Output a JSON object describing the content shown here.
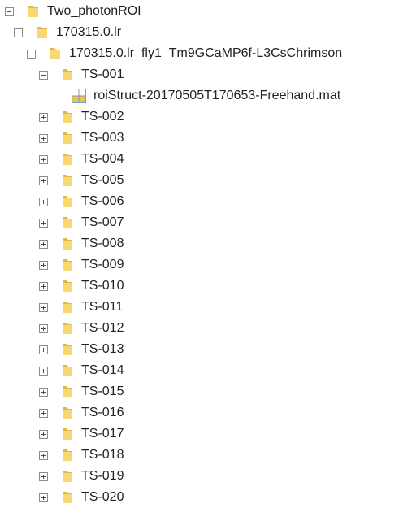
{
  "tree": {
    "root": {
      "label": "Two_photonROI",
      "expanded": true
    },
    "date_folder": {
      "label": "170315.0.lr",
      "expanded": true
    },
    "fly_folder": {
      "label": "170315.0.lr_fly1_Tm9GCaMP6f-L3CsChrimson",
      "expanded": true
    },
    "ts_expanded": {
      "label": "TS-001",
      "expanded": true
    },
    "file": {
      "label": "roiStruct-20170505T170653-Freehand.mat",
      "icon": "mat-file-icon"
    },
    "ts_collapsed": [
      {
        "label": "TS-002"
      },
      {
        "label": "TS-003"
      },
      {
        "label": "TS-004"
      },
      {
        "label": "TS-005"
      },
      {
        "label": "TS-006"
      },
      {
        "label": "TS-007"
      },
      {
        "label": "TS-008"
      },
      {
        "label": "TS-009"
      },
      {
        "label": "TS-010"
      },
      {
        "label": "TS-011"
      },
      {
        "label": "TS-012"
      },
      {
        "label": "TS-013"
      },
      {
        "label": "TS-014"
      },
      {
        "label": "TS-015"
      },
      {
        "label": "TS-016"
      },
      {
        "label": "TS-017"
      },
      {
        "label": "TS-018"
      },
      {
        "label": "TS-019"
      },
      {
        "label": "TS-020"
      }
    ]
  },
  "colors": {
    "folder_fill": "#f8d775",
    "folder_back": "#e0b84a",
    "toggle_border": "#8c8c8c",
    "file_grid": "#6e9fd0",
    "file_fill": "#f2c14e"
  }
}
